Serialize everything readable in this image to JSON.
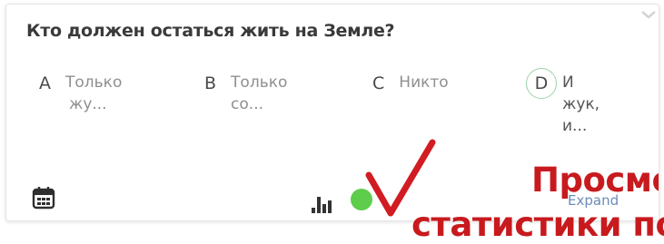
{
  "poll": {
    "question": "Кто должен остаться жить на Земле?",
    "options": [
      {
        "letter": "A",
        "line1": "Только",
        "line2": "жу..."
      },
      {
        "letter": "B",
        "line1": "Только",
        "line2": "со..."
      },
      {
        "letter": "C",
        "line1": "Никто",
        "line2": ""
      },
      {
        "letter": "D",
        "line1": "И",
        "line2": "жук,",
        "line3": "и..."
      }
    ],
    "selected_option": "D",
    "expand_label": "Expand"
  },
  "icons": {
    "calendar": "calendar-icon",
    "collapse": "chevron-down-icon",
    "stats": "bar-chart-icon",
    "status": "online-dot-icon",
    "check": "checkmark-icon"
  },
  "overlay": {
    "line1": "Просмо",
    "line2": "статистики по"
  },
  "colors": {
    "accent_red": "#c81a1e",
    "status_green": "#5dcd4b",
    "selected_ring": "#9ad3a8",
    "link_blue": "#6a8cb8"
  }
}
